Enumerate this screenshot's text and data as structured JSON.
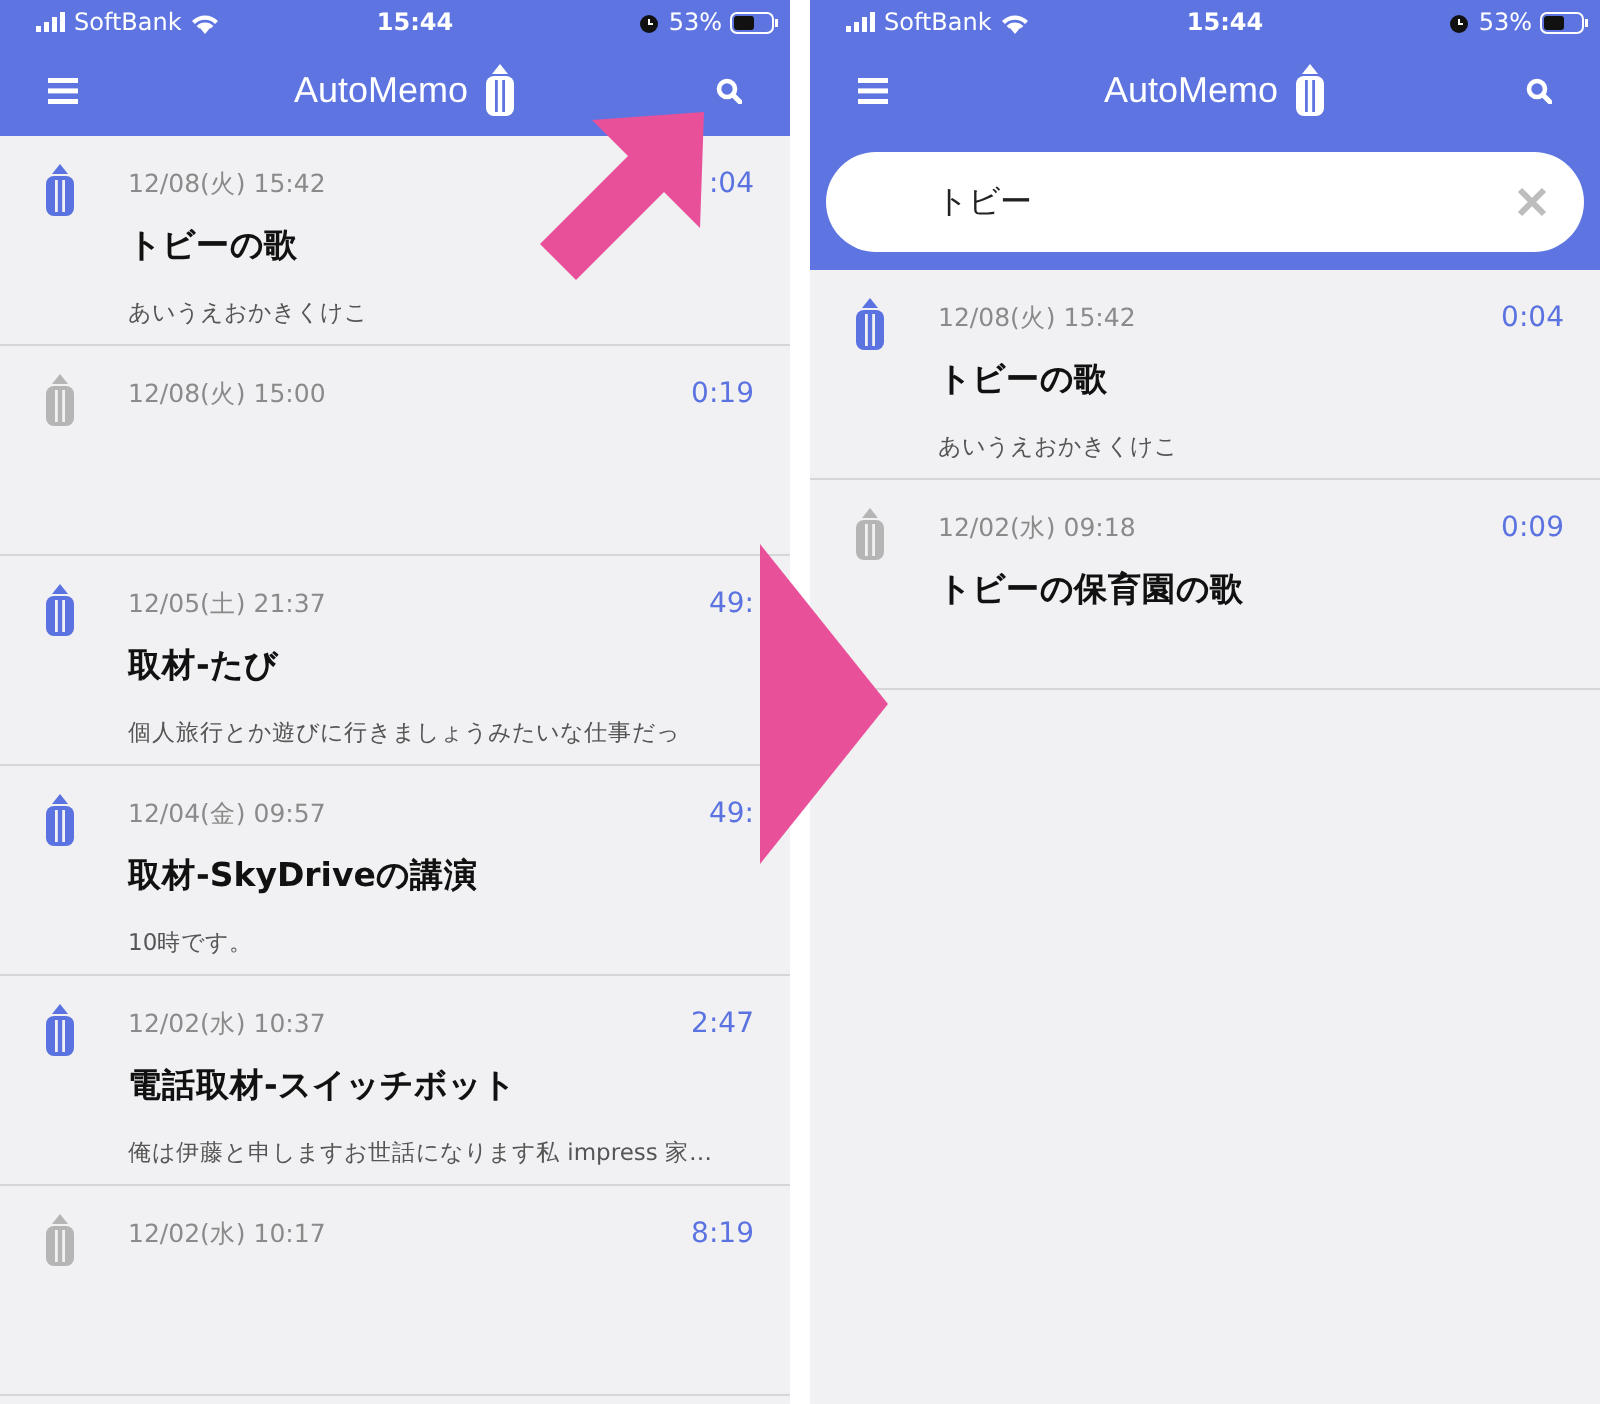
{
  "screens": [
    {
      "status_bar": {
        "carrier": "SoftBank",
        "time": "15:44",
        "battery": "53%"
      },
      "app_bar": {
        "title": "AutoMemo"
      },
      "memos": [
        {
          "date": "12/08(火) 15:42",
          "duration": ":04",
          "title": "トビーの歌",
          "preview": "あいうえおかきくけこ",
          "color": "#5b73e0"
        },
        {
          "date": "12/08(火) 15:00",
          "duration": "0:19",
          "color": "#b5b5b5"
        },
        {
          "date": "12/05(土) 21:37",
          "duration": "49:",
          "title": "取材-たび",
          "preview": "個人旅行とか遊びに行きましょうみたいな仕事だっ",
          "color": "#5b73e0"
        },
        {
          "date": "12/04(金) 09:57",
          "duration": "49:",
          "title": "取材-SkyDriveの講演",
          "preview": "10時です。",
          "color": "#5b73e0"
        },
        {
          "date": "12/02(水) 10:37",
          "duration": "2:47",
          "title": "電話取材-スイッチボット",
          "preview": "俺は伊藤と申しますお世話になります私 impress 家…",
          "color": "#5b73e0"
        },
        {
          "date": "12/02(水) 10:17",
          "duration": "8:19",
          "color": "#b5b5b5"
        }
      ]
    },
    {
      "status_bar": {
        "carrier": "SoftBank",
        "time": "15:44",
        "battery": "53%"
      },
      "app_bar": {
        "title": "AutoMemo"
      },
      "search": {
        "value": "トビー"
      },
      "memos": [
        {
          "date": "12/08(火) 15:42",
          "duration": "0:04",
          "title": "トビーの歌",
          "preview": "あいうえおかきくけこ",
          "color": "#5b73e0"
        },
        {
          "date": "12/02(水) 09:18",
          "duration": "0:09",
          "title": "トビーの保育園の歌",
          "color": "#b5b5b5"
        }
      ]
    }
  ]
}
